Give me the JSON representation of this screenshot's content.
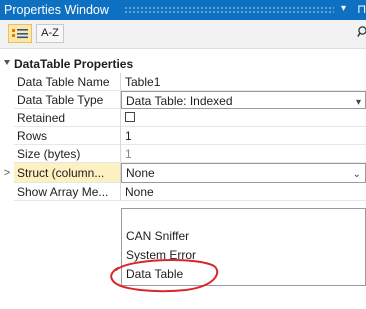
{
  "window": {
    "title": "Properties Window"
  },
  "titlebar_icons": {
    "dropdown": "▾",
    "pin": "⊓"
  },
  "toolbar": {
    "categorized_icon": "categorized-list-icon",
    "az_label": "A-Z",
    "search_icon": "search-icon"
  },
  "section": {
    "label": "DataTable Properties"
  },
  "rows": [
    {
      "name": "Data Table Name",
      "value": "Table1"
    },
    {
      "name": "Data Table Type",
      "value": "Data Table: Indexed"
    },
    {
      "name": "Retained",
      "value": ""
    },
    {
      "name": "Rows",
      "value": "1"
    },
    {
      "name": "Size (bytes)",
      "value": "1"
    },
    {
      "name": "Struct (column...",
      "value": "None",
      "expander": ">"
    },
    {
      "name": "Show Array Me...",
      "value": "None"
    }
  ],
  "dropdown": {
    "options": [
      "CAN Sniffer",
      "System Error",
      "Data Table"
    ]
  },
  "colors": {
    "titlebar": "#0e70c0",
    "selected_row": "#fdf0c1",
    "annotation": "#d9262b"
  }
}
